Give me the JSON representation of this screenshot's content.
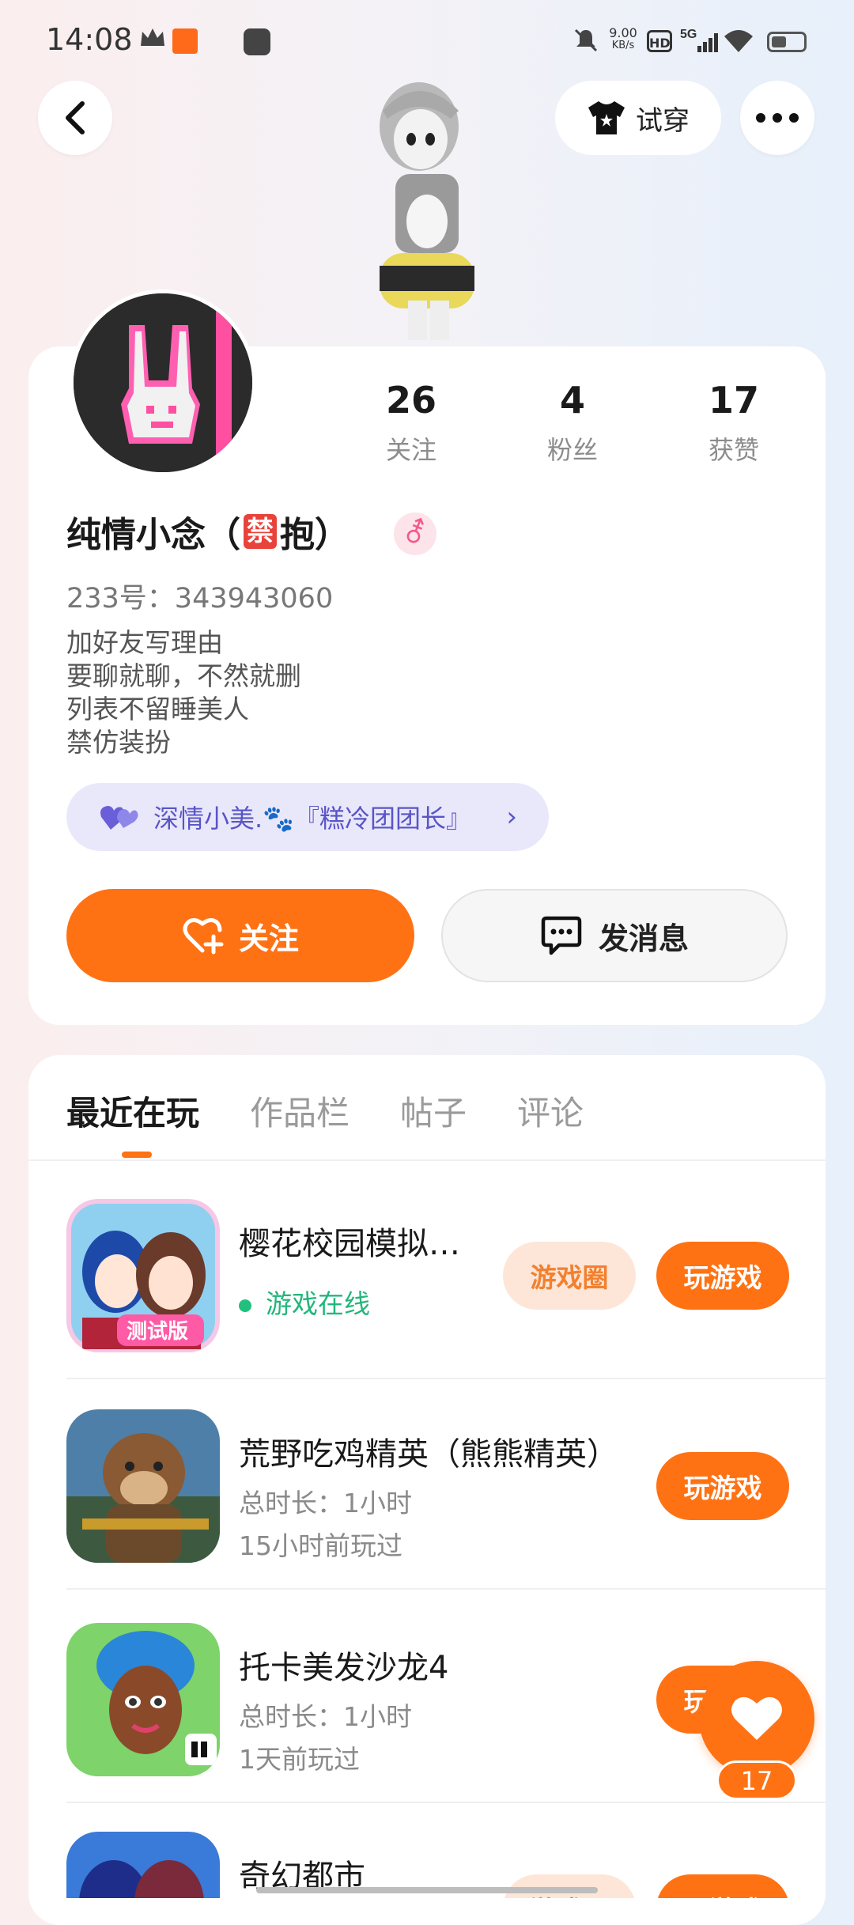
{
  "status_bar": {
    "time": "14:08",
    "net_speed_value": "9.00",
    "net_speed_unit": "KB/s",
    "hd": "HD",
    "network": "5G"
  },
  "header": {
    "tryon_label": "试穿"
  },
  "profile": {
    "stats": [
      {
        "num": "26",
        "label": "关注"
      },
      {
        "num": "4",
        "label": "粉丝"
      },
      {
        "num": "17",
        "label": "获赞"
      }
    ],
    "name_prefix": "纯情小念（",
    "name_badge": "禁",
    "name_suffix": "抱）",
    "gender_symbol": "⚦",
    "uid": "233号：343943060",
    "bio": [
      "加好友写理由",
      "要聊就聊，不然就删",
      "列表不留睡美人",
      "禁仿装扮"
    ],
    "relation": "深情小美.🐾『糕冷团团长』",
    "follow_label": "关注",
    "message_label": "发消息"
  },
  "tabs": [
    "最近在玩",
    "作品栏",
    "帖子",
    "评论"
  ],
  "games": [
    {
      "title": "樱花校园模拟…",
      "status": "游戏在线",
      "circle_label": "游戏圈",
      "play_label": "玩游戏"
    },
    {
      "title": "荒野吃鸡精英（熊熊精英）",
      "duration": "总时长：1小时",
      "last_played": "15小时前玩过",
      "play_label": "玩游戏"
    },
    {
      "title": "托卡美发沙龙4",
      "duration": "总时长：1小时",
      "last_played": "1天前玩过",
      "play_label": "玩游戏"
    },
    {
      "title": "奇幻都市",
      "circle_label": "游戏圈",
      "play_label": "玩游戏"
    }
  ],
  "like_fab": {
    "count": "17"
  },
  "colors": {
    "accent": "#ff7214",
    "online": "#22b67a",
    "relation_bg": "#e9e8fb",
    "relation_text": "#5a55c6"
  }
}
